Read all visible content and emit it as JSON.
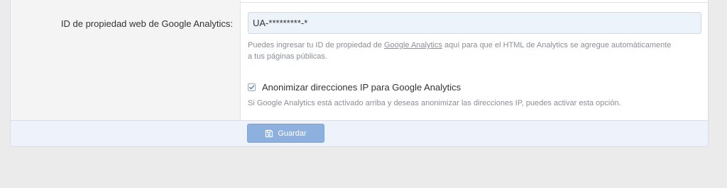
{
  "form": {
    "ga_property_label": "ID de propiedad web de Google Analytics:",
    "ga_property_value": "UA-*********-*",
    "ga_help_prefix": "Puedes ingresar tu ID de propiedad de ",
    "ga_help_link": "Google Analytics",
    "ga_help_suffix": " aquí para que el HTML de Analytics se agregue automáticamente a tus páginas públicas.",
    "anonymize_checked": true,
    "anonymize_label": "Anonimizar direcciones IP para Google Analytics",
    "anonymize_help": "Si Google Analytics está activado arriba y deseas anonimizar las direcciones IP, puedes activar esta opción."
  },
  "footer": {
    "save_label": "Guardar",
    "save_icon": "floppy-disk-icon"
  },
  "colors": {
    "page_background": "#ebebeb",
    "input_background": "#edf3fb",
    "button_background": "#8db0df",
    "checkbox_check": "#4a7fc1",
    "footer_background": "#eef2fa"
  }
}
